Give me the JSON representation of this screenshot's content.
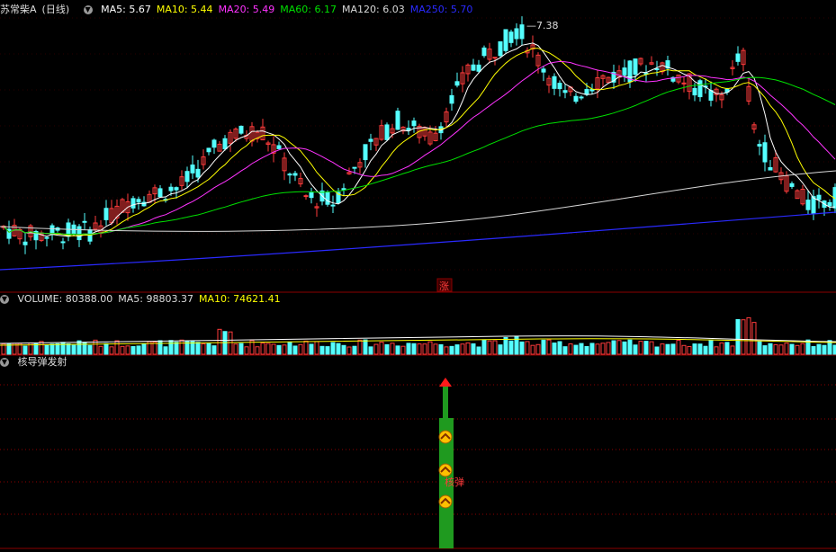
{
  "colors": {
    "up": "#ff3b3b",
    "down": "#54ffff",
    "ma5": "#ffffff",
    "ma10": "#ffff00",
    "ma20": "#ff33ff",
    "ma60": "#00e000",
    "ma120": "#d8d8d8",
    "ma250": "#2a2aff",
    "grid": "#8b0000",
    "rocket_body": "#1f9a1f",
    "rocket_tip": "#ff1a1a",
    "signal": "#ffc000"
  },
  "price_panel": {
    "stock": "苏常柴A",
    "period": "(日线)",
    "ma_labels": [
      {
        "label": "MA5: 5.67",
        "color": "#ffffff"
      },
      {
        "label": "MA10: 5.44",
        "color": "#ffff00"
      },
      {
        "label": "MA20: 5.49",
        "color": "#ff33ff"
      },
      {
        "label": "MA60: 6.17",
        "color": "#00e000"
      },
      {
        "label": "MA120: 6.03",
        "color": "#d8d8d8"
      },
      {
        "label": "MA250: 5.70",
        "color": "#2a2aff"
      }
    ],
    "high_marker": "7.38",
    "zhang_tag": "涨"
  },
  "volume_panel": {
    "labels": [
      {
        "label": "VOLUME: 80388.00",
        "color": "#dddddd"
      },
      {
        "label": "MA5: 98803.37",
        "color": "#dddddd"
      },
      {
        "label": "MA10: 74621.41",
        "color": "#ffff00"
      }
    ]
  },
  "indicator_panel": {
    "title": "核导弹发射",
    "signal_text": "核弹"
  },
  "chart_data": {
    "type": "candlestick",
    "title": "苏常柴A (日线)",
    "price_high_label": 7.38,
    "ma_latest": {
      "MA5": 5.67,
      "MA10": 5.44,
      "MA20": 5.49,
      "MA60": 6.17,
      "MA120": 6.03,
      "MA250": 5.7
    },
    "volume_latest": {
      "VOLUME": 80388.0,
      "MA5": 98803.37,
      "MA10": 74621.41
    },
    "indicator": "核导弹发射"
  }
}
